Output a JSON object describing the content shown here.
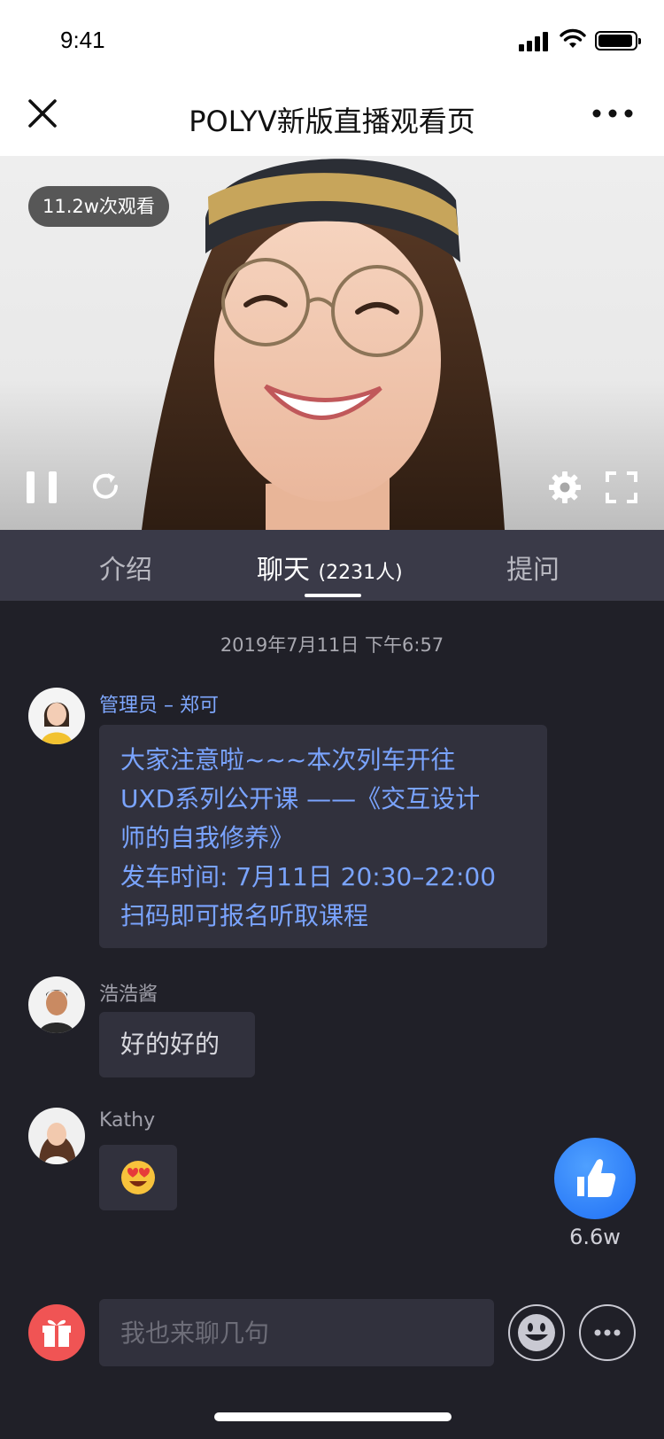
{
  "status_bar": {
    "time": "9:41"
  },
  "nav": {
    "title": "POLYV新版直播观看页",
    "close_icon": "close-icon",
    "more_icon": "more-horizontal-icon"
  },
  "video": {
    "views_badge": "11.2w次观看",
    "controls": [
      "pause-icon",
      "refresh-icon",
      "settings-icon",
      "fullscreen-icon"
    ]
  },
  "tabs": {
    "intro": "介绍",
    "chat": "聊天",
    "chat_count": "(2231人)",
    "ask": "提问",
    "active": "chat"
  },
  "chat": {
    "timestamp": "2019年7月11日 下午6:57",
    "messages": [
      {
        "sender": "管理员 – 郑可",
        "role": "admin",
        "lines": [
          "大家注意啦~~~本次列车开往",
          "UXD系列公开课 ——《交互设计",
          "师的自我修养》",
          "发车时间: 7月11日 20:30–22:00",
          "扫码即可报名听取课程"
        ]
      },
      {
        "sender": "浩浩酱",
        "role": "user",
        "text": "好的好的"
      },
      {
        "sender": "Kathy",
        "role": "user",
        "emoji": "heart-eyes-emoji"
      }
    ]
  },
  "like": {
    "count": "6.6w",
    "icon": "thumbs-up-icon"
  },
  "input_bar": {
    "placeholder": "我也来聊几句",
    "gift_icon": "gift-icon",
    "emoji_icon": "smiley-icon",
    "more_icon": "more-horizontal-icon"
  },
  "colors": {
    "accent": "#1f6ff5",
    "admin_text": "#7aa4ff",
    "gift": "#f05454",
    "background": "#202028"
  }
}
